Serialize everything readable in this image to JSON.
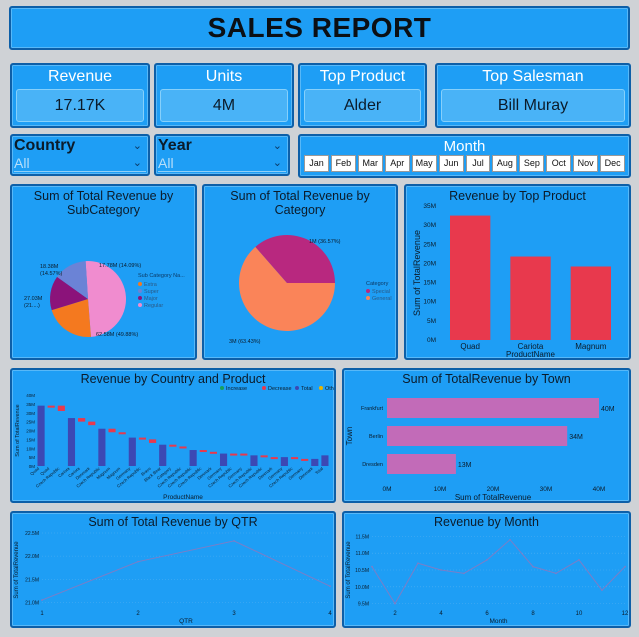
{
  "header": {
    "title": "SALES REPORT"
  },
  "kpis": [
    {
      "label": "Revenue",
      "value": "17.17K"
    },
    {
      "label": "Units",
      "value": "4M"
    },
    {
      "label": "Top Product",
      "value": "Alder"
    },
    {
      "label": "Top Salesman",
      "value": "Bill Muray"
    }
  ],
  "slicers": {
    "country": {
      "label": "Country",
      "value": "All"
    },
    "year": {
      "label": "Year",
      "value": "All"
    },
    "month": {
      "label": "Month",
      "months": [
        "Jan",
        "Feb",
        "Mar",
        "Apr",
        "May",
        "Jun",
        "Jul",
        "Aug",
        "Sep",
        "Oct",
        "Nov",
        "Dec"
      ]
    }
  },
  "chart_data": [
    {
      "type": "pie",
      "title": "Sum of Total Revenue by SubCategory",
      "legend_title": "Sub Category Na...",
      "legend": [
        "Extra",
        "Super",
        "Major",
        "Regular"
      ],
      "slices": [
        {
          "name": "Regular",
          "value": 62.58,
          "label": "62.58M (49.88%)",
          "color": "#f08ccf"
        },
        {
          "name": "Extra",
          "value": 27.03,
          "label": "27.03M (21....)",
          "color": "#f4791f"
        },
        {
          "name": "Major",
          "value": 18.38,
          "label": "18.38M (14.57%)",
          "color": "#8b137a"
        },
        {
          "name": "Super",
          "value": 17.78,
          "label": "17.78M (14.09%)",
          "color": "#6b83d6"
        }
      ]
    },
    {
      "type": "pie",
      "title": "Sum of Total Revenue by Category",
      "legend_title": "Category",
      "legend": [
        "Special",
        "General"
      ],
      "slices": [
        {
          "name": "General",
          "value": 3,
          "label": "3M (63.43%)",
          "color": "#fa8459"
        },
        {
          "name": "Special",
          "value": 1.72,
          "label": "1M (36.57%)",
          "color": "#b8287f"
        }
      ]
    },
    {
      "type": "bar",
      "title": "Revenue by Top Product",
      "xlabel": "ProductName",
      "ylabel": "Sum of TotalRevenue",
      "categories": [
        "Quad",
        "Cariota",
        "Magnum"
      ],
      "values": [
        32.5,
        21.8,
        19.2
      ],
      "ylim": [
        0,
        35
      ],
      "yticks": [
        "0M",
        "5M",
        "10M",
        "15M",
        "20M",
        "25M",
        "30M",
        "35M"
      ],
      "color": "#e8394d"
    },
    {
      "type": "bar",
      "subtype": "waterfall",
      "title": "Revenue by Country and Product",
      "xlabel": "ProductName",
      "ylabel": "Sum of TotalRevenue",
      "legend": [
        "Increase",
        "Decrease",
        "Total",
        "Other"
      ],
      "legend_colors": [
        "#18a05a",
        "#e8394d",
        "#3c48b4",
        "#e8b400"
      ],
      "yticks": [
        "0M",
        "5M",
        "10M",
        "15M",
        "20M",
        "25M",
        "30M",
        "35M",
        "40M"
      ],
      "categories": [
        "Quad",
        "Quad",
        "Czech Republic",
        "Cariota",
        "Cariota",
        "Denmark",
        "Czech Republic",
        "Magnum",
        "Magnum",
        "Germany",
        "Czech Republic",
        "Bravo",
        "Black Bear",
        "Category",
        "Czech Republic",
        "Czech Republic",
        "Czech Republic",
        "Denmark",
        "Germany",
        "Czech Republic",
        "Germany",
        "Czech Republic",
        "Czech Republic",
        "Denmark",
        "Germany",
        "Czech Republic",
        "Germany",
        "Denmark",
        "Total"
      ],
      "values": [
        34,
        34,
        31,
        27,
        25,
        23,
        21,
        19,
        18,
        16,
        15,
        13,
        12,
        11,
        10,
        9,
        8,
        8,
        7,
        7,
        6,
        6,
        5,
        5,
        5,
        4,
        4,
        4,
        6
      ],
      "ylim": [
        0,
        40
      ]
    },
    {
      "type": "bar",
      "subtype": "horizontal",
      "title": "Sum of TotalRevenue by Town",
      "xlabel": "Sum of TotalRevenue",
      "ylabel": "Town",
      "categories": [
        "Frankfurt",
        "Berlin",
        "Dresden"
      ],
      "values": [
        40,
        34,
        13
      ],
      "labels": [
        "40M",
        "34M",
        "13M"
      ],
      "xlim": [
        0,
        40
      ],
      "xticks": [
        "0M",
        "10M",
        "20M",
        "30M",
        "40M"
      ],
      "color": "#c26bb8"
    },
    {
      "type": "line",
      "title": "Sum of Total Revenue by QTR",
      "xlabel": "QTR",
      "ylabel": "Sum of TotalRevenue",
      "x": [
        1,
        2,
        3,
        4
      ],
      "y": [
        21.05,
        21.88,
        22.33,
        21.35
      ],
      "ylim": [
        20.9,
        22.5
      ],
      "yticks": [
        "21.0M",
        "21.5M",
        "22.0M",
        "22.5M"
      ],
      "color": "#7a7ec8"
    },
    {
      "type": "line",
      "title": "Revenue by Month",
      "xlabel": "Month",
      "ylabel": "Sum of TotalRevenue",
      "x": [
        1,
        2,
        3,
        4,
        5,
        6,
        7,
        8,
        9,
        10,
        11,
        12
      ],
      "y": [
        10.6,
        9.5,
        10.7,
        10.5,
        10.4,
        10.8,
        11.4,
        10.6,
        10.4,
        10.8,
        9.9,
        10.6
      ],
      "ylim": [
        9.4,
        11.6
      ],
      "yticks": [
        "9.5M",
        "10.0M",
        "10.5M",
        "11.0M",
        "11.5M"
      ],
      "xticks": [
        "2",
        "4",
        "6",
        "8",
        "10",
        "12"
      ],
      "color": "#7a7ec8"
    }
  ]
}
